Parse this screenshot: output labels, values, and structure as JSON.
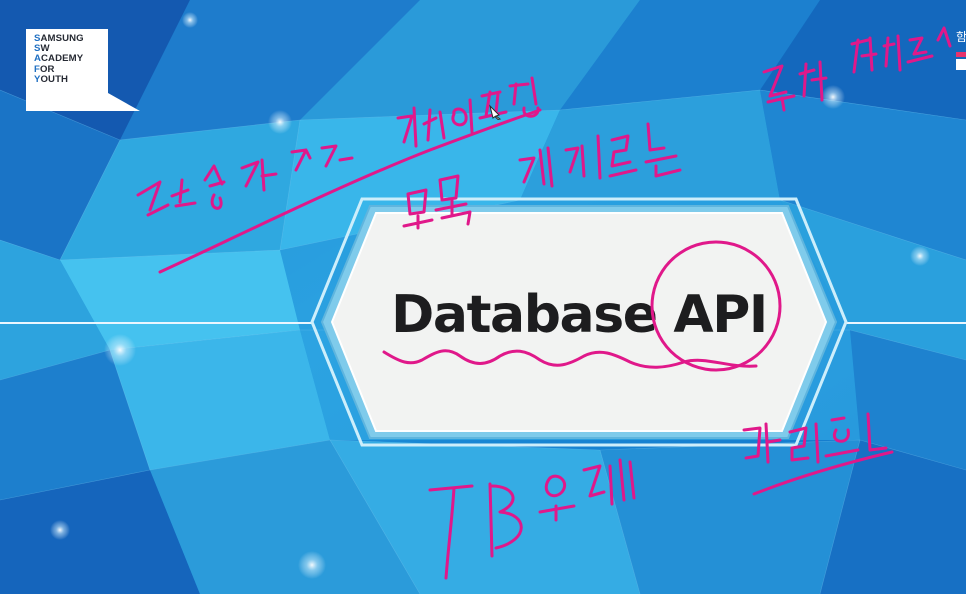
{
  "slide": {
    "title": "Database API"
  },
  "logo": {
    "lines": [
      {
        "initial": "S",
        "rest": "AMSUNG"
      },
      {
        "initial": "S",
        "rest": "W"
      },
      {
        "initial": "A",
        "rest": "CADEMY"
      },
      {
        "initial": "F",
        "rest": "OR"
      },
      {
        "initial": "Y",
        "rest": "OUTH"
      }
    ]
  },
  "corner": {
    "text": "함",
    "brand_color": "#e8336d"
  },
  "annotations": {
    "ink_color": "#e0188a",
    "handwritten": [
      "작성자가",
      "검색패턴",
      "모든 게시글을",
      "조회 패턴",
      "DB 요청",
      "대화"
    ]
  },
  "colors": {
    "background_dark": "#0d4f9c",
    "background_light": "#33b4e8",
    "title_box_fill": "#f2f3f2",
    "title_box_border": "#8fd2ee"
  }
}
